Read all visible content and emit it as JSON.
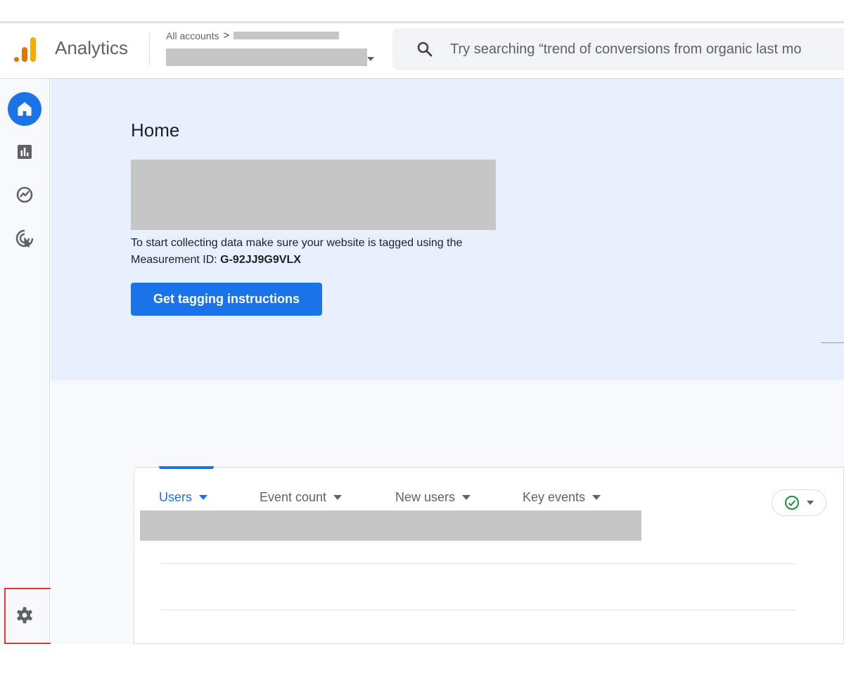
{
  "header": {
    "brand": "Analytics",
    "breadcrumb_root": "All accounts",
    "breadcrumb_separator": ">",
    "search_placeholder": "Try searching “trend of conversions from organic last mo"
  },
  "sidebar": {
    "items": [
      {
        "name": "home",
        "icon": "home-icon",
        "active": true
      },
      {
        "name": "reports",
        "icon": "bar-chart-icon",
        "active": false
      },
      {
        "name": "explore",
        "icon": "explore-icon",
        "active": false
      },
      {
        "name": "advertising",
        "icon": "ads-target-icon",
        "active": false
      }
    ],
    "settings_icon": "gear-icon"
  },
  "hero": {
    "title": "Home",
    "info_line1": "To start collecting data make sure your website is tagged using the",
    "info_prefix": "Measurement ID: ",
    "measurement_id": "G-92JJ9G9VLX",
    "cta_label": "Get tagging instructions"
  },
  "card": {
    "metrics": [
      {
        "label": "Users",
        "active": true
      },
      {
        "label": "Event count",
        "active": false
      },
      {
        "label": "New users",
        "active": false
      },
      {
        "label": "Key events",
        "active": false
      }
    ]
  },
  "colors": {
    "accent": "#1a73e8",
    "hero_bg": "#e8f0fe",
    "highlight": "#e53935",
    "logo_orange": "#f9ab00",
    "logo_dark_orange": "#e37400",
    "status_green": "#1e8e3e"
  }
}
